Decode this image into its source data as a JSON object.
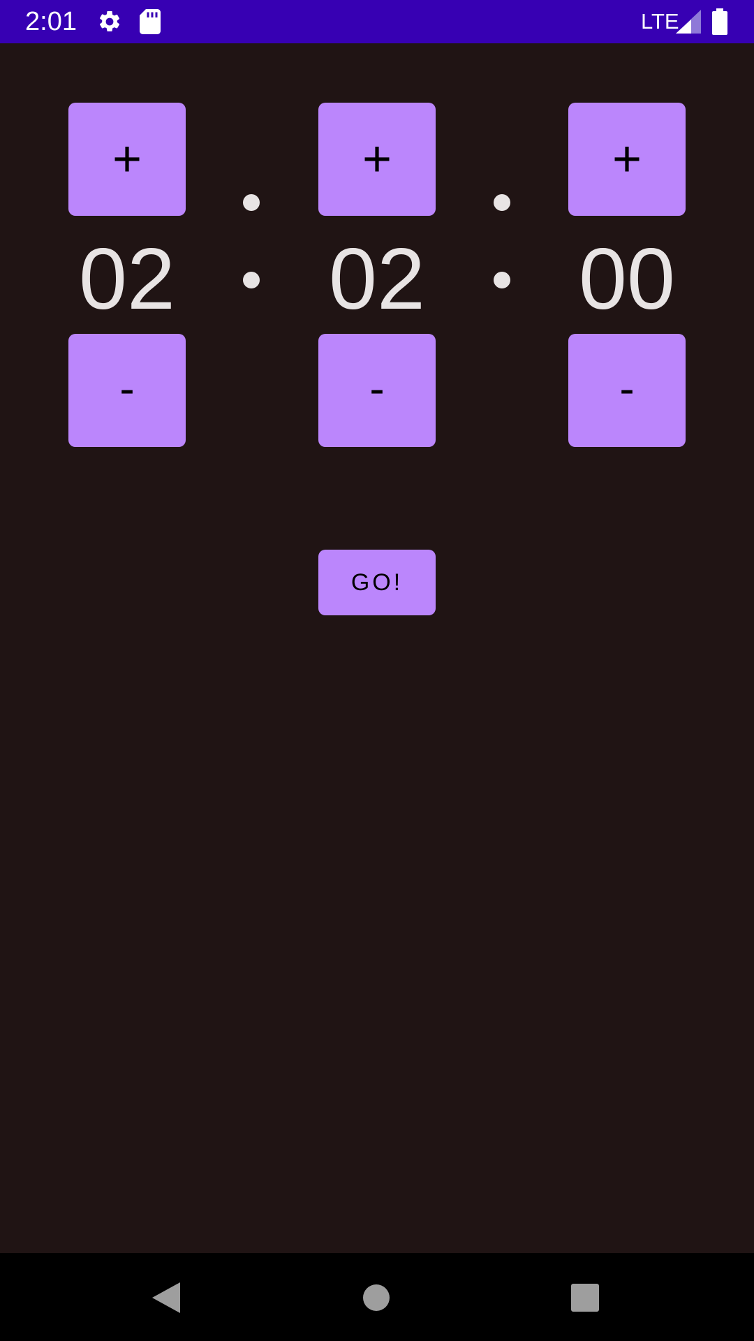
{
  "status_bar": {
    "time": "2:01",
    "network": "LTE",
    "background_color": "#3700b3",
    "icons": [
      "settings-icon",
      "sd-card-icon",
      "signal-icon",
      "battery-icon"
    ]
  },
  "timer": {
    "hours": "02",
    "minutes": "02",
    "seconds": "00",
    "increment_label": "+",
    "decrement_label": "-",
    "separator": ":"
  },
  "go_button": {
    "label": "GO!"
  },
  "colors": {
    "accent": "#bb86fc",
    "background": "#201414",
    "text": "#e8e4e4",
    "nav_background": "#000000"
  },
  "nav_bar": {
    "icons": [
      "back-icon",
      "home-icon",
      "recents-icon"
    ]
  }
}
